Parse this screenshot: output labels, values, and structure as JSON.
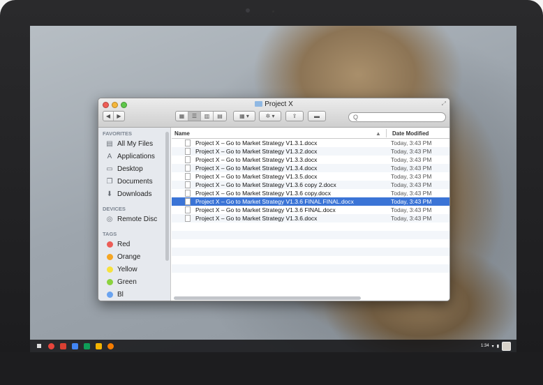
{
  "window": {
    "title": "Project X"
  },
  "toolbar": {
    "back_icon": "back-arrow-icon",
    "forward_icon": "forward-arrow-icon",
    "view_modes": [
      "icon-view",
      "list-view",
      "column-view",
      "cover-flow-view"
    ],
    "active_view": "list-view",
    "search_placeholder": "Q"
  },
  "sidebar": {
    "favorites_header": "FAVORITES",
    "favorites": [
      {
        "label": "All My Files",
        "icon": "all-files-icon"
      },
      {
        "label": "Applications",
        "icon": "applications-icon"
      },
      {
        "label": "Desktop",
        "icon": "desktop-icon"
      },
      {
        "label": "Documents",
        "icon": "documents-icon"
      },
      {
        "label": "Downloads",
        "icon": "downloads-icon"
      }
    ],
    "devices_header": "DEVICES",
    "devices": [
      {
        "label": "Remote Disc",
        "icon": "disc-icon"
      }
    ],
    "tags_header": "TAGS",
    "tags": [
      {
        "label": "Red",
        "color": "#ec5d57"
      },
      {
        "label": "Orange",
        "color": "#f5a623"
      },
      {
        "label": "Yellow",
        "color": "#f7e23e"
      },
      {
        "label": "Green",
        "color": "#8bd23f"
      },
      {
        "label": "Bl",
        "color": "#6aa3f0"
      }
    ]
  },
  "list": {
    "col_name": "Name",
    "col_date": "Date Modified",
    "sort_indicator": "▲",
    "files": [
      {
        "name": "Project X – Go to Market Strategy V1.3.1.docx",
        "date": "Today, 3:43 PM",
        "selected": false
      },
      {
        "name": "Project X – Go to Market Strategy V1.3.2.docx",
        "date": "Today, 3:43 PM",
        "selected": false
      },
      {
        "name": "Project X – Go to Market Strategy V1.3.3.docx",
        "date": "Today, 3:43 PM",
        "selected": false
      },
      {
        "name": "Project X – Go to Market Strategy V1.3.4.docx",
        "date": "Today, 3:43 PM",
        "selected": false
      },
      {
        "name": "Project X – Go to Market Strategy V1.3.5.docx",
        "date": "Today, 3:43 PM",
        "selected": false
      },
      {
        "name": "Project X – Go to Market Strategy V1.3.6 copy 2.docx",
        "date": "Today, 3:43 PM",
        "selected": false
      },
      {
        "name": "Project X – Go to Market Strategy V1.3.6 copy.docx",
        "date": "Today, 3:43 PM",
        "selected": false
      },
      {
        "name": "Project X – Go to Market Strategy V1.3.6 FINAL FINAL.docx",
        "date": "Today, 3:43 PM",
        "selected": true
      },
      {
        "name": "Project X – Go to Market Strategy V1.3.6 FINAL.docx",
        "date": "Today, 3:43 PM",
        "selected": false
      },
      {
        "name": "Project X – Go to Market Strategy V1.3.6.docx",
        "date": "Today, 3:43 PM",
        "selected": false
      }
    ]
  },
  "shelf": {
    "apps": [
      {
        "name": "chrome-icon",
        "color": "#e8453c"
      },
      {
        "name": "gmail-icon",
        "color": "#d94032"
      },
      {
        "name": "docs-icon",
        "color": "#4285f4"
      },
      {
        "name": "sheets-icon",
        "color": "#0f9d58"
      },
      {
        "name": "slides-icon",
        "color": "#f4b400"
      },
      {
        "name": "music-icon",
        "color": "#f57c00"
      }
    ],
    "clock": "1:34"
  },
  "colors": {
    "selection": "#3b74d6",
    "sidebar_bg": "#e6e9ee"
  }
}
